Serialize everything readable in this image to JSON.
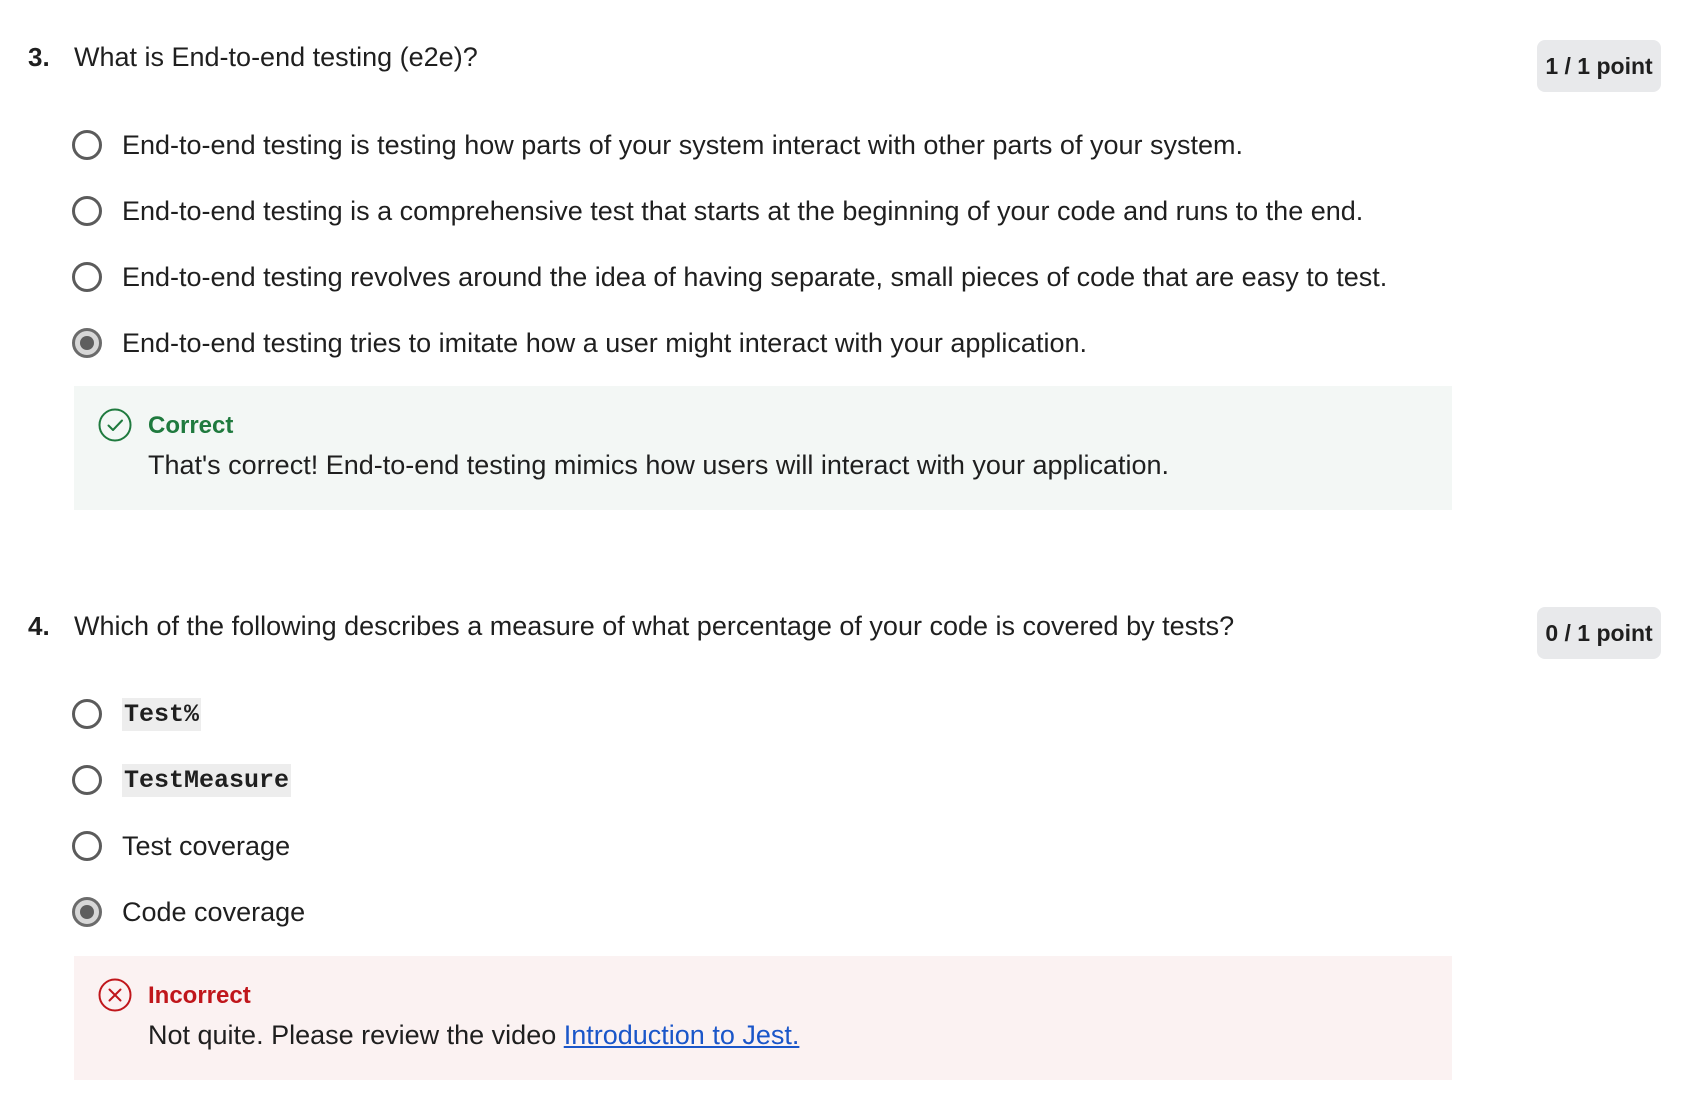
{
  "questions": [
    {
      "number": "3.",
      "text": "What is End-to-end testing (e2e)?",
      "points": "1 / 1 point",
      "options": [
        {
          "label": "End-to-end testing is testing how parts of your system interact with other parts of your system.",
          "selected": false
        },
        {
          "label": "End-to-end testing is a comprehensive test that starts at the beginning of your code and runs to the end.",
          "selected": false
        },
        {
          "label": "End-to-end testing revolves around the idea of having separate, small pieces of code that are easy to test.",
          "selected": false
        },
        {
          "label": "End-to-end testing tries to imitate how a user might interact with your application.",
          "selected": true
        }
      ],
      "feedback": {
        "status": "Correct",
        "message": "That's correct! End-to-end testing mimics how users will interact with your application.",
        "icon": "check-circle-icon",
        "color": "#1f7a3e"
      }
    },
    {
      "number": "4.",
      "text": "Which of the following describes a measure of what percentage of your code is covered by tests?",
      "points": "0 / 1 point",
      "options": [
        {
          "label": "Test%",
          "selected": false,
          "code": true
        },
        {
          "label": "TestMeasure",
          "selected": false,
          "code": true
        },
        {
          "label": "Test coverage",
          "selected": false
        },
        {
          "label": "Code coverage",
          "selected": true
        }
      ],
      "feedback": {
        "status": "Incorrect",
        "message": "Not quite. Please review the video ",
        "link_text": "Introduction to Jest.",
        "icon": "x-circle-icon",
        "color": "#c0161b"
      }
    }
  ]
}
